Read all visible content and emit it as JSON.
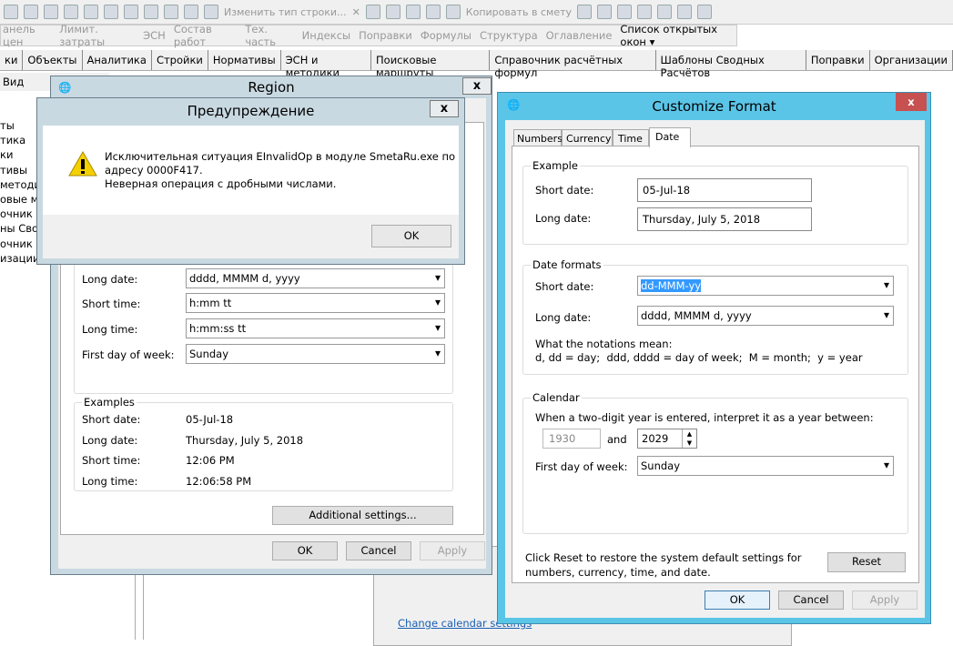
{
  "app": {
    "toolbar": {
      "change_row_type": "Изменить тип строки...",
      "copy_to_estimate": "Копировать в смету"
    },
    "menu": [
      "анель цен",
      "Лимит. затраты",
      "ЭСН",
      "Состав работ",
      "Тех. часть",
      "Индексы",
      "Поправки",
      "Формулы",
      "Структура",
      "Оглавление"
    ],
    "menu_open_windows": "Список открытых окон ▾",
    "tabs": [
      "ки",
      "Объекты",
      "Аналитика",
      "Стройки",
      "Нормативы",
      "ЭСН и методики",
      "Поисковые маршруты",
      "Справочник расчётных формул",
      "Шаблоны Сводных Расчётов",
      "Поправки",
      "Организации"
    ],
    "view_label": "Вид",
    "tree": [
      "ты",
      "тика",
      "ки",
      "тивы",
      "методик",
      "овые ма",
      "очник ра",
      "ны Свод",
      "очник по",
      "изации"
    ]
  },
  "background_window": {
    "change_calendar_link": "Change calendar settings"
  },
  "region": {
    "title": "Region",
    "rows": [
      {
        "label": "Long date:",
        "value": "dddd, MMMM d, yyyy"
      },
      {
        "label": "Short time:",
        "value": "h:mm tt"
      },
      {
        "label": "Long time:",
        "value": "h:mm:ss tt"
      },
      {
        "label": "First day of week:",
        "value": "Sunday"
      }
    ],
    "examples_title": "Examples",
    "examples": [
      {
        "label": "Short date:",
        "value": "05-Jul-18"
      },
      {
        "label": "Long date:",
        "value": "Thursday, July 5, 2018"
      },
      {
        "label": "Short time:",
        "value": "12:06 PM"
      },
      {
        "label": "Long time:",
        "value": "12:06:58 PM"
      }
    ],
    "additional": "Additional settings...",
    "ok": "OK",
    "cancel": "Cancel",
    "apply": "Apply"
  },
  "warning": {
    "title": "Предупреждение",
    "line1": "Исключительная ситуация EInvalidOp в модуле SmetaRu.exe по",
    "line2": "адресу 0000F417.",
    "line3": "Неверная операция с дробными числами.",
    "ok": "OK",
    "icon": "warning-icon"
  },
  "customize": {
    "title": "Customize Format",
    "tabs": [
      "Numbers",
      "Currency",
      "Time",
      "Date"
    ],
    "active_tab": "Date",
    "example_title": "Example",
    "short_date_label": "Short date:",
    "short_date_example": "05-Jul-18",
    "long_date_label": "Long date:",
    "long_date_example": "Thursday, July 5, 2018",
    "formats_title": "Date formats",
    "short_date_format": "dd-MMM-yy",
    "long_date_format": "dddd, MMMM d, yyyy",
    "notation_title": "What the notations mean:",
    "notation": "d, dd = day;  ddd, dddd = day of week;  M = month;  y = year",
    "calendar_title": "Calendar",
    "calendar_text": "When a two-digit year is entered, interpret it as a year between:",
    "year_from": "1930",
    "and": "and",
    "year_to": "2029",
    "first_day_label": "First day of week:",
    "first_day": "Sunday",
    "reset_text1": "Click Reset to restore the system default settings for",
    "reset_text2": "numbers, currency, time, and date.",
    "reset": "Reset",
    "ok": "OK",
    "cancel": "Cancel",
    "apply": "Apply",
    "colors": {
      "frame": "#5bc5e8",
      "close": "#c75050",
      "selection": "#3399ff"
    }
  }
}
